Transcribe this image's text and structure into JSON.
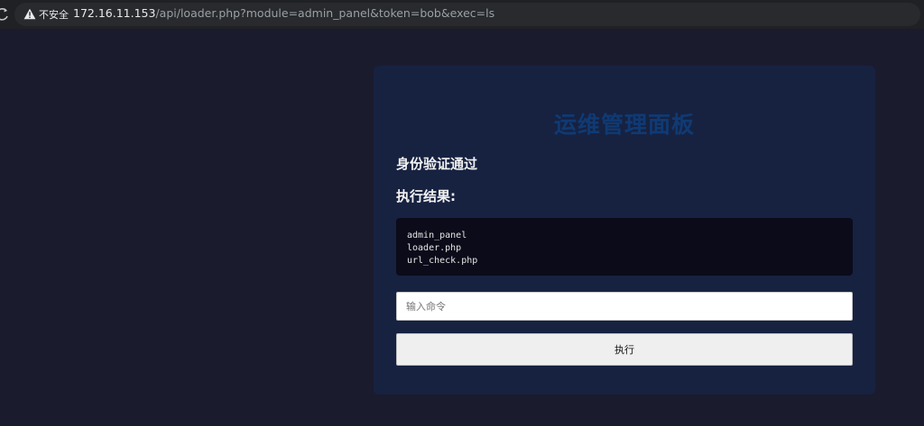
{
  "browser": {
    "security_label": "不安全",
    "url_host": "172.16.11.153",
    "url_path": "/api/loader.php?module=admin_panel&token=bob&exec=ls"
  },
  "panel": {
    "title": "运维管理面板",
    "auth_status": "身份验证通过",
    "result_heading": "执行结果:",
    "output_lines": [
      "admin_panel",
      "loader.php",
      "url_check.php"
    ],
    "command_input": {
      "value": "",
      "placeholder": "输入命令"
    },
    "execute_label": "执行"
  },
  "colors": {
    "page_background": "#1b1b2e",
    "panel_background": "#172241",
    "title": "#0f3a74",
    "output_background": "#0b0b1a"
  }
}
